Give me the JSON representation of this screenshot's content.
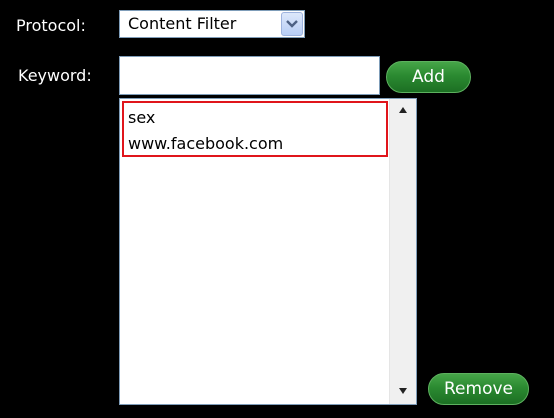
{
  "form": {
    "protocol_label": "Protocol:",
    "protocol_value": "Content Filter",
    "keyword_label": "Keyword:",
    "keyword_value": "",
    "add_label": "Add",
    "remove_label": "Remove"
  },
  "keyword_list": [
    "sex",
    "www.facebook.com"
  ],
  "colors": {
    "background": "#000000",
    "button_green": "#2b8a31",
    "highlight_red": "#e0151b",
    "field_border": "#7f9db9"
  },
  "icons": {
    "select_arrow": "chevron-down-icon",
    "scroll_up": "triangle-up-icon",
    "scroll_down": "triangle-down-icon"
  }
}
